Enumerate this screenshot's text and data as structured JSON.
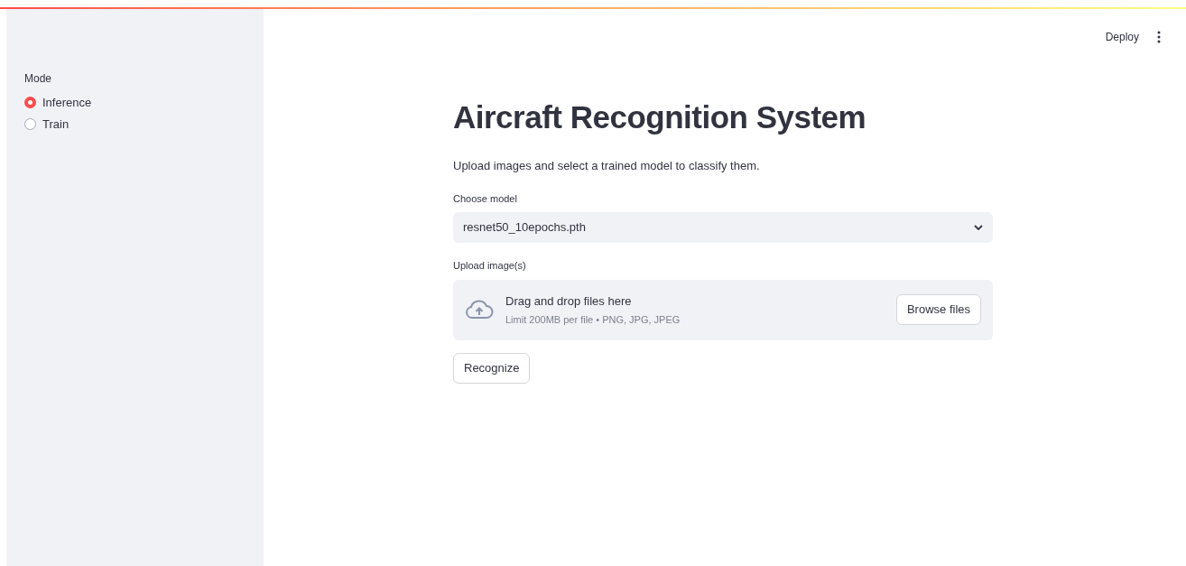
{
  "sidebar": {
    "label": "Mode",
    "options": [
      {
        "label": "Inference",
        "selected": true
      },
      {
        "label": "Train",
        "selected": false
      }
    ]
  },
  "header": {
    "deploy": "Deploy"
  },
  "main": {
    "title": "Aircraft Recognition System",
    "description": "Upload images and select a trained model to classify them.",
    "model_select": {
      "label": "Choose model",
      "value": "resnet50_10epochs.pth"
    },
    "uploader": {
      "label": "Upload image(s)",
      "instruction": "Drag and drop files here",
      "limit": "Limit 200MB per file • PNG, JPG, JPEG",
      "button": "Browse files"
    },
    "action_button": "Recognize"
  }
}
